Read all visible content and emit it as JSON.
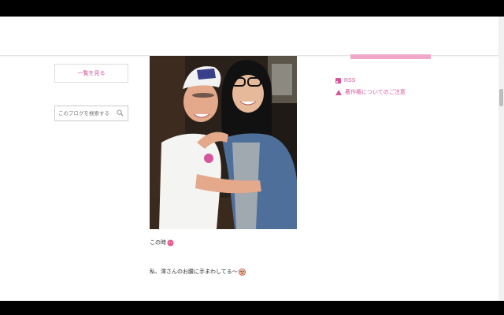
{
  "sidebar": {
    "list_button_label": "一覧を見る",
    "search_placeholder": "このブログを検索する",
    "search_icon": "search-icon"
  },
  "post": {
    "photo": "photo-two-women-hugging",
    "caption_1": "この時",
    "caption_1_emoji": "heart-face-emoji",
    "caption_2": "私、澤さんのお腰に手まわしてる〜",
    "caption_2_emoji": "surprised-face-emoji"
  },
  "right_sidebar": {
    "rss_label": "RSS",
    "report_label": "著作権についてのご注意"
  },
  "colors": {
    "accent": "#d6559c",
    "accent_bar": "#f1a8c8"
  }
}
